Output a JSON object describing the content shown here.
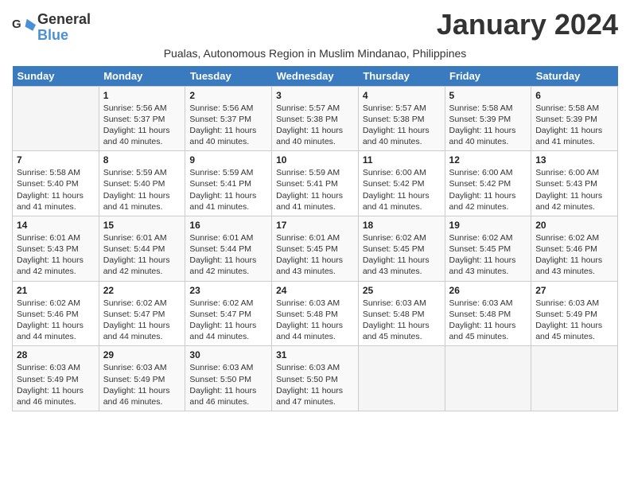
{
  "logo": {
    "line1": "General",
    "line2": "Blue"
  },
  "title": "January 2024",
  "subtitle": "Pualas, Autonomous Region in Muslim Mindanao, Philippines",
  "days_of_week": [
    "Sunday",
    "Monday",
    "Tuesday",
    "Wednesday",
    "Thursday",
    "Friday",
    "Saturday"
  ],
  "weeks": [
    [
      {
        "day": "",
        "sunrise": "",
        "sunset": "",
        "daylight": ""
      },
      {
        "day": "1",
        "sunrise": "Sunrise: 5:56 AM",
        "sunset": "Sunset: 5:37 PM",
        "daylight": "Daylight: 11 hours and 40 minutes."
      },
      {
        "day": "2",
        "sunrise": "Sunrise: 5:56 AM",
        "sunset": "Sunset: 5:37 PM",
        "daylight": "Daylight: 11 hours and 40 minutes."
      },
      {
        "day": "3",
        "sunrise": "Sunrise: 5:57 AM",
        "sunset": "Sunset: 5:38 PM",
        "daylight": "Daylight: 11 hours and 40 minutes."
      },
      {
        "day": "4",
        "sunrise": "Sunrise: 5:57 AM",
        "sunset": "Sunset: 5:38 PM",
        "daylight": "Daylight: 11 hours and 40 minutes."
      },
      {
        "day": "5",
        "sunrise": "Sunrise: 5:58 AM",
        "sunset": "Sunset: 5:39 PM",
        "daylight": "Daylight: 11 hours and 40 minutes."
      },
      {
        "day": "6",
        "sunrise": "Sunrise: 5:58 AM",
        "sunset": "Sunset: 5:39 PM",
        "daylight": "Daylight: 11 hours and 41 minutes."
      }
    ],
    [
      {
        "day": "7",
        "sunrise": "Sunrise: 5:58 AM",
        "sunset": "Sunset: 5:40 PM",
        "daylight": "Daylight: 11 hours and 41 minutes."
      },
      {
        "day": "8",
        "sunrise": "Sunrise: 5:59 AM",
        "sunset": "Sunset: 5:40 PM",
        "daylight": "Daylight: 11 hours and 41 minutes."
      },
      {
        "day": "9",
        "sunrise": "Sunrise: 5:59 AM",
        "sunset": "Sunset: 5:41 PM",
        "daylight": "Daylight: 11 hours and 41 minutes."
      },
      {
        "day": "10",
        "sunrise": "Sunrise: 5:59 AM",
        "sunset": "Sunset: 5:41 PM",
        "daylight": "Daylight: 11 hours and 41 minutes."
      },
      {
        "day": "11",
        "sunrise": "Sunrise: 6:00 AM",
        "sunset": "Sunset: 5:42 PM",
        "daylight": "Daylight: 11 hours and 41 minutes."
      },
      {
        "day": "12",
        "sunrise": "Sunrise: 6:00 AM",
        "sunset": "Sunset: 5:42 PM",
        "daylight": "Daylight: 11 hours and 42 minutes."
      },
      {
        "day": "13",
        "sunrise": "Sunrise: 6:00 AM",
        "sunset": "Sunset: 5:43 PM",
        "daylight": "Daylight: 11 hours and 42 minutes."
      }
    ],
    [
      {
        "day": "14",
        "sunrise": "Sunrise: 6:01 AM",
        "sunset": "Sunset: 5:43 PM",
        "daylight": "Daylight: 11 hours and 42 minutes."
      },
      {
        "day": "15",
        "sunrise": "Sunrise: 6:01 AM",
        "sunset": "Sunset: 5:44 PM",
        "daylight": "Daylight: 11 hours and 42 minutes."
      },
      {
        "day": "16",
        "sunrise": "Sunrise: 6:01 AM",
        "sunset": "Sunset: 5:44 PM",
        "daylight": "Daylight: 11 hours and 42 minutes."
      },
      {
        "day": "17",
        "sunrise": "Sunrise: 6:01 AM",
        "sunset": "Sunset: 5:45 PM",
        "daylight": "Daylight: 11 hours and 43 minutes."
      },
      {
        "day": "18",
        "sunrise": "Sunrise: 6:02 AM",
        "sunset": "Sunset: 5:45 PM",
        "daylight": "Daylight: 11 hours and 43 minutes."
      },
      {
        "day": "19",
        "sunrise": "Sunrise: 6:02 AM",
        "sunset": "Sunset: 5:45 PM",
        "daylight": "Daylight: 11 hours and 43 minutes."
      },
      {
        "day": "20",
        "sunrise": "Sunrise: 6:02 AM",
        "sunset": "Sunset: 5:46 PM",
        "daylight": "Daylight: 11 hours and 43 minutes."
      }
    ],
    [
      {
        "day": "21",
        "sunrise": "Sunrise: 6:02 AM",
        "sunset": "Sunset: 5:46 PM",
        "daylight": "Daylight: 11 hours and 44 minutes."
      },
      {
        "day": "22",
        "sunrise": "Sunrise: 6:02 AM",
        "sunset": "Sunset: 5:47 PM",
        "daylight": "Daylight: 11 hours and 44 minutes."
      },
      {
        "day": "23",
        "sunrise": "Sunrise: 6:02 AM",
        "sunset": "Sunset: 5:47 PM",
        "daylight": "Daylight: 11 hours and 44 minutes."
      },
      {
        "day": "24",
        "sunrise": "Sunrise: 6:03 AM",
        "sunset": "Sunset: 5:48 PM",
        "daylight": "Daylight: 11 hours and 44 minutes."
      },
      {
        "day": "25",
        "sunrise": "Sunrise: 6:03 AM",
        "sunset": "Sunset: 5:48 PM",
        "daylight": "Daylight: 11 hours and 45 minutes."
      },
      {
        "day": "26",
        "sunrise": "Sunrise: 6:03 AM",
        "sunset": "Sunset: 5:48 PM",
        "daylight": "Daylight: 11 hours and 45 minutes."
      },
      {
        "day": "27",
        "sunrise": "Sunrise: 6:03 AM",
        "sunset": "Sunset: 5:49 PM",
        "daylight": "Daylight: 11 hours and 45 minutes."
      }
    ],
    [
      {
        "day": "28",
        "sunrise": "Sunrise: 6:03 AM",
        "sunset": "Sunset: 5:49 PM",
        "daylight": "Daylight: 11 hours and 46 minutes."
      },
      {
        "day": "29",
        "sunrise": "Sunrise: 6:03 AM",
        "sunset": "Sunset: 5:49 PM",
        "daylight": "Daylight: 11 hours and 46 minutes."
      },
      {
        "day": "30",
        "sunrise": "Sunrise: 6:03 AM",
        "sunset": "Sunset: 5:50 PM",
        "daylight": "Daylight: 11 hours and 46 minutes."
      },
      {
        "day": "31",
        "sunrise": "Sunrise: 6:03 AM",
        "sunset": "Sunset: 5:50 PM",
        "daylight": "Daylight: 11 hours and 47 minutes."
      },
      {
        "day": "",
        "sunrise": "",
        "sunset": "",
        "daylight": ""
      },
      {
        "day": "",
        "sunrise": "",
        "sunset": "",
        "daylight": ""
      },
      {
        "day": "",
        "sunrise": "",
        "sunset": "",
        "daylight": ""
      }
    ]
  ]
}
